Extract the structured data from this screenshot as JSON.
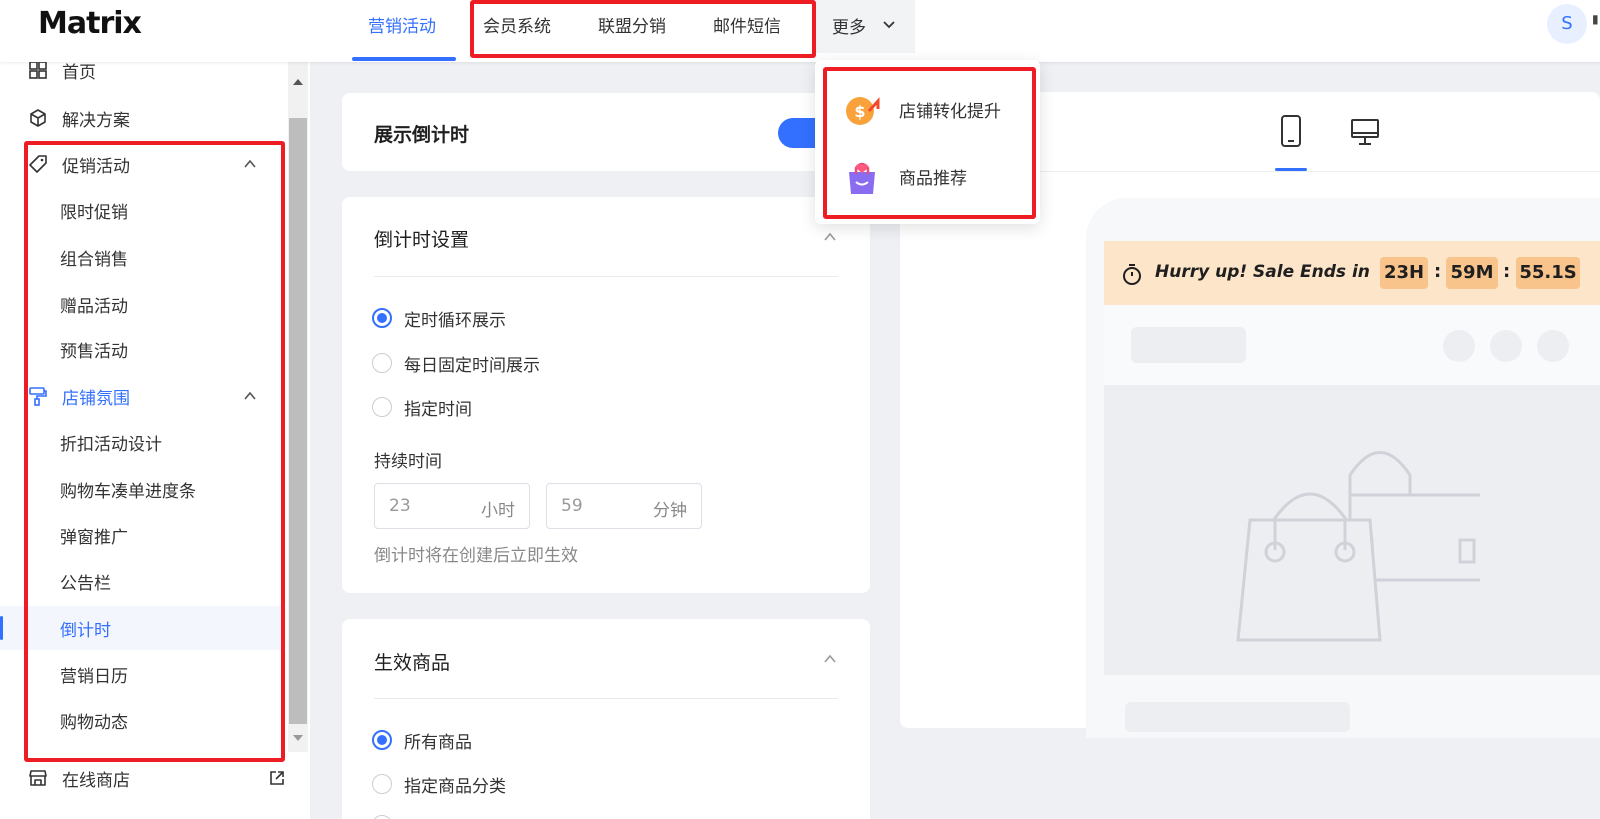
{
  "header": {
    "logo": "Matrix",
    "nav": [
      {
        "label": "营销活动",
        "active": true
      },
      {
        "label": "会员系统",
        "active": false
      },
      {
        "label": "联盟分销",
        "active": false
      },
      {
        "label": "邮件短信",
        "active": false
      }
    ],
    "more_label": "更多",
    "avatar_initial": "S"
  },
  "dropdown": {
    "items": [
      {
        "label": "店铺转化提升",
        "icon": "coin-up-icon"
      },
      {
        "label": "商品推荐",
        "icon": "shopping-bag-icon"
      }
    ]
  },
  "sidebar": {
    "items": [
      {
        "label": "首页",
        "icon": "home-icon",
        "level": 1
      },
      {
        "label": "解决方案",
        "icon": "cube-icon",
        "level": 1
      },
      {
        "label": "促销活动",
        "icon": "tag-icon",
        "level": 1,
        "expanded": true
      },
      {
        "label": "限时促销",
        "level": 2
      },
      {
        "label": "组合销售",
        "level": 2
      },
      {
        "label": "赠品活动",
        "level": 2
      },
      {
        "label": "预售活动",
        "level": 2
      },
      {
        "label": "店铺氛围",
        "icon": "paint-roller-icon",
        "level": 1,
        "expanded": true,
        "highlight": true
      },
      {
        "label": "折扣活动设计",
        "level": 2
      },
      {
        "label": "购物车凑单进度条",
        "level": 2
      },
      {
        "label": "弹窗推广",
        "level": 2
      },
      {
        "label": "公告栏",
        "level": 2
      },
      {
        "label": "倒计时",
        "level": 2,
        "active": true
      },
      {
        "label": "营销日历",
        "level": 2
      },
      {
        "label": "购物动态",
        "level": 2
      }
    ],
    "footer_item": {
      "label": "在线商店",
      "icon": "store-icon"
    }
  },
  "main": {
    "show_countdown": {
      "label": "展示倒计时",
      "enabled": true
    },
    "countdown_settings": {
      "title": "倒计时设置",
      "options": [
        {
          "label": "定时循环展示",
          "selected": true
        },
        {
          "label": "每日固定时间展示",
          "selected": false
        },
        {
          "label": "指定时间",
          "selected": false
        }
      ],
      "duration_label": "持续时间",
      "hours": {
        "value": "23",
        "unit": "小时"
      },
      "minutes": {
        "value": "59",
        "unit": "分钟"
      },
      "hint": "倒计时将在创建后立即生效"
    },
    "effective_products": {
      "title": "生效商品",
      "options": [
        {
          "label": "所有商品",
          "selected": true
        },
        {
          "label": "指定商品分类",
          "selected": false
        }
      ]
    }
  },
  "preview": {
    "countdown_text": "Hurry up! Sale Ends in",
    "hours": "23H",
    "minutes": "59M",
    "seconds": "55.1S",
    "separator": ":"
  },
  "colors": {
    "accent": "#3370ff",
    "highlight_box": "#ee1d23",
    "countdown_bg": "#fde5c9",
    "countdown_box": "#f8c48b"
  }
}
